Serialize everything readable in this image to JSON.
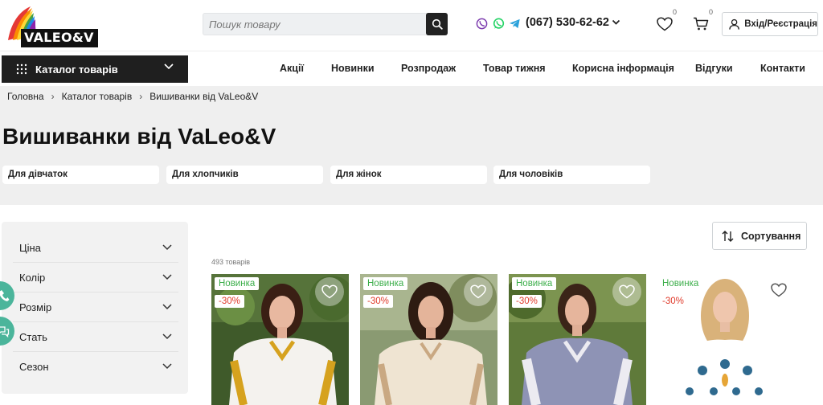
{
  "header": {
    "logo_text": "VALEO&V",
    "search_placeholder": "Пошук товару",
    "phone": "(067) 530-62-62",
    "wishlist_count": "0",
    "cart_count": "0",
    "login_label": "Вхід/Реєстрація",
    "icons": [
      "search-icon",
      "viber-icon",
      "whatsapp-icon",
      "telegram-icon",
      "chevron-down-icon",
      "heart-icon",
      "cart-icon",
      "user-icon"
    ]
  },
  "nav": {
    "catalog_label": "Каталог товарів",
    "items": [
      "Акції",
      "Новинки",
      "Розпродаж",
      "Товар тижня",
      "Корисна інформація",
      "Відгуки",
      "Контакти"
    ]
  },
  "breadcrumb": [
    "Головна",
    "Каталог товарів",
    "Вишиванки від VaLeo&V"
  ],
  "page_title": "Вишиванки від VaLeo&V",
  "subcategories": [
    "Для дівчаток",
    "Для хлопчиків",
    "Для жінок",
    "Для чоловіків"
  ],
  "filters": [
    "Ціна",
    "Колір",
    "Розмір",
    "Стать",
    "Сезон"
  ],
  "sort_label": "Сортування",
  "items_count": "493 товарів",
  "products": [
    {
      "badge_new": "Новинка",
      "badge_discount": "-30%",
      "embroidery_color": "#d6a21e",
      "shirt_color": "#f4f2ee"
    },
    {
      "badge_new": "Новинка",
      "badge_discount": "-30%",
      "embroidery_color": "#c9a882",
      "shirt_color": "#efe4d2"
    },
    {
      "badge_new": "Новинка",
      "badge_discount": "-30%",
      "embroidery_color": "#ecebf1",
      "shirt_color": "#8e93b5"
    },
    {
      "badge_new": "Новинка",
      "badge_discount": "-30%",
      "embroidery_color": "#2f6a8f",
      "shirt_color": "#ffffff"
    }
  ],
  "colors": {
    "accent_dark": "#1f1f1f",
    "badge_new": "#3cae4a",
    "badge_sale": "#e03a2a",
    "floating_button": "#4bb59b"
  }
}
